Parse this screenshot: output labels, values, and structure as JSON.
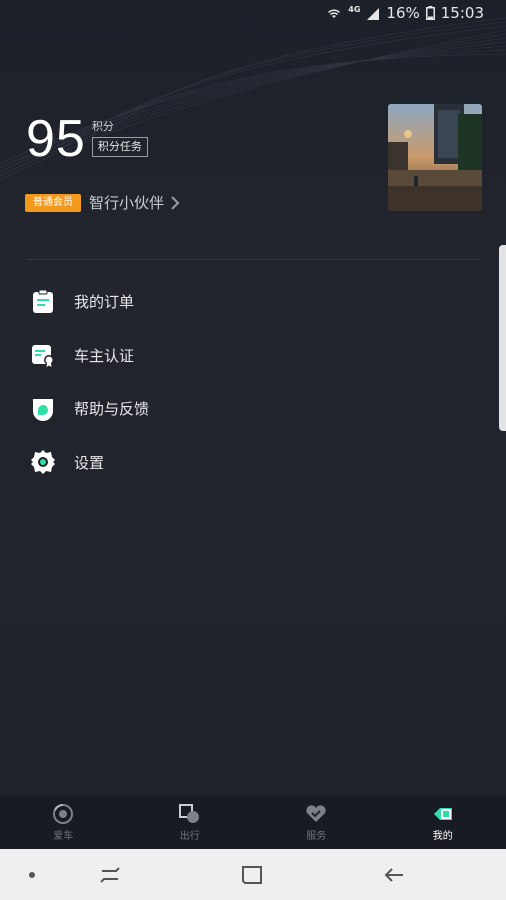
{
  "status_bar": {
    "network": "4G",
    "battery": "16%",
    "time": "15:03"
  },
  "profile": {
    "points_value": "95",
    "points_unit": "积分",
    "points_task_label": "积分任务",
    "member_badge": "普通会员",
    "member_name": "智行小伙伴"
  },
  "menu": {
    "items": [
      {
        "label": "我的订单",
        "icon": "order-icon"
      },
      {
        "label": "车主认证",
        "icon": "owner-certify-icon"
      },
      {
        "label": "帮助与反馈",
        "icon": "help-feedback-icon"
      },
      {
        "label": "设置",
        "icon": "settings-icon"
      }
    ]
  },
  "tabs": [
    {
      "label": "爱车",
      "icon": "car-icon",
      "active": false
    },
    {
      "label": "出行",
      "icon": "travel-icon",
      "active": false
    },
    {
      "label": "服务",
      "icon": "service-icon",
      "active": false
    },
    {
      "label": "我的",
      "icon": "mine-icon",
      "active": true
    }
  ],
  "colors": {
    "accent": "#2ee0a8",
    "badge": "#f39a1e",
    "background": "#1f2229"
  }
}
